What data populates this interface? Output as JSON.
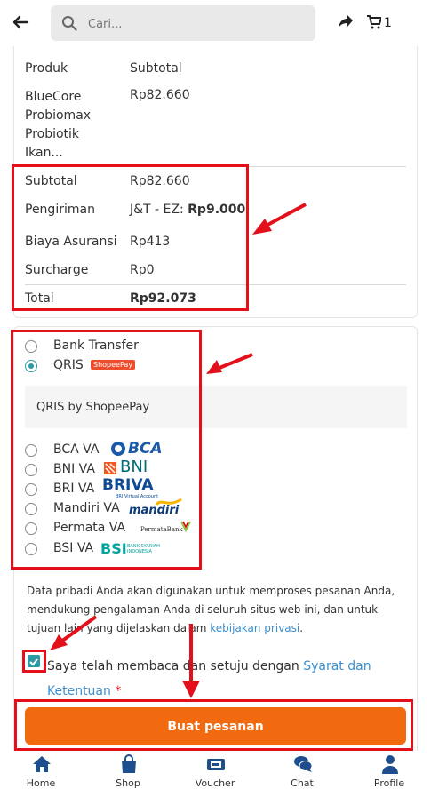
{
  "header": {
    "search_placeholder": "Cari...",
    "cart_count": "1"
  },
  "order": {
    "col_product": "Produk",
    "col_subtotal": "Subtotal",
    "product_name": "BlueCore Probiomax Probiotik Ikan...",
    "product_price": "Rp82.660",
    "subtotal_label": "Subtotal",
    "subtotal_value": "Rp82.660",
    "shipping_label": "Pengiriman",
    "shipping_method": "J&T - EZ:",
    "shipping_cost": "Rp9.000",
    "insurance_label": "Biaya Asuransi",
    "insurance_value": "Rp413",
    "surcharge_label": "Surcharge",
    "surcharge_value": "Rp0",
    "total_label": "Total",
    "total_value": "Rp92.073"
  },
  "payment": {
    "methods": [
      {
        "label": "Bank Transfer",
        "selected": false
      },
      {
        "label": "QRIS",
        "selected": true,
        "logo": "ShopeePay"
      },
      {
        "label": "BCA VA",
        "selected": false,
        "logo": "BCA"
      },
      {
        "label": "BNI VA",
        "selected": false,
        "logo": "BNI"
      },
      {
        "label": "BRI VA",
        "selected": false,
        "logo": "BRIVA"
      },
      {
        "label": "Mandiri VA",
        "selected": false,
        "logo": "mandiri"
      },
      {
        "label": "Permata VA",
        "selected": false,
        "logo": "PermataBank"
      },
      {
        "label": "BSI VA",
        "selected": false,
        "logo": "BSI"
      }
    ],
    "qris_note": "QRIS by ShopeePay",
    "logo_briva_sub": "BRI Virtual Account",
    "logo_bsi_sub": "BANK SYARIAH INDONESIA"
  },
  "privacy": {
    "text": "Data pribadi Anda akan digunakan untuk memproses pesanan Anda, mendukung pengalaman Anda di seluruh situs web ini, dan untuk tujuan lain yang dijelaskan dalam ",
    "link": "kebijakan privasi",
    "end": "."
  },
  "agreement": {
    "text": "Saya telah membaca dan setuju dengan ",
    "link": "Syarat dan Ketentuan",
    "required": "*",
    "checked": true
  },
  "submit_label": "Buat pesanan",
  "nav": [
    {
      "label": "Home",
      "icon": "home-icon"
    },
    {
      "label": "Shop",
      "icon": "shopping-bag-icon"
    },
    {
      "label": "Voucher",
      "icon": "ticket-icon"
    },
    {
      "label": "Chat",
      "icon": "chat-icon"
    },
    {
      "label": "Profile",
      "icon": "user-icon"
    }
  ],
  "colors": {
    "accent": "#f26a10",
    "highlight": "#e3101c",
    "radio": "#2b9aa6",
    "icons": "#1e4f8c"
  }
}
